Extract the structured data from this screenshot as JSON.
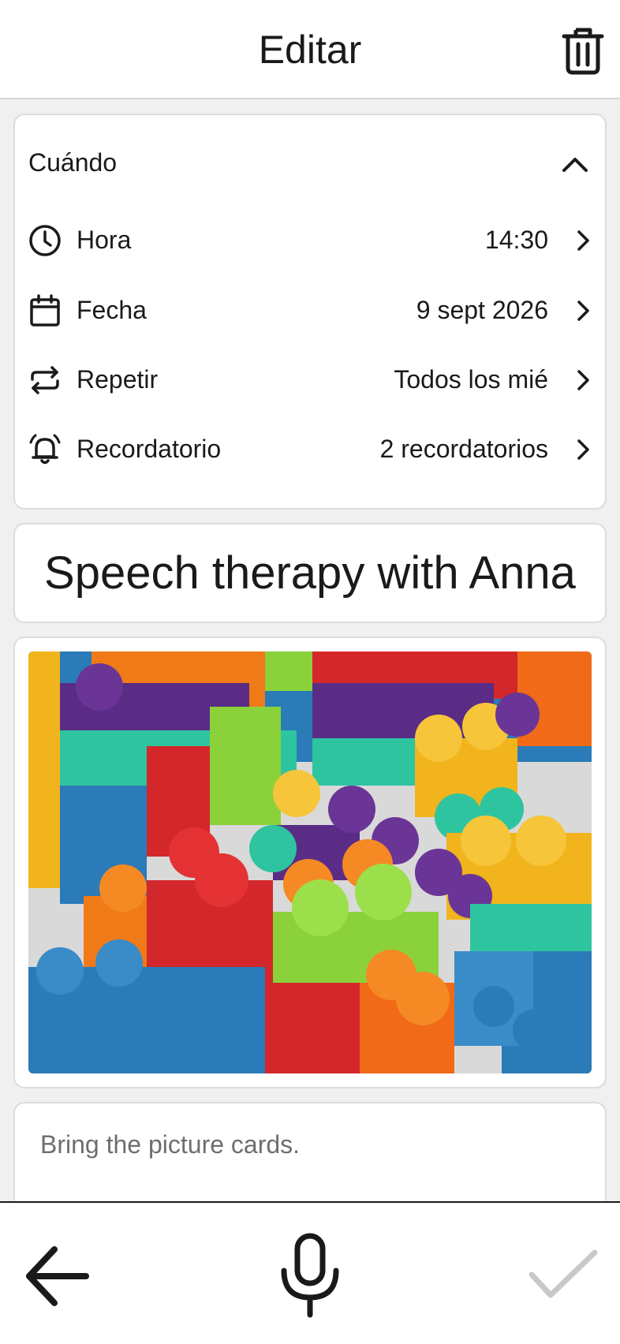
{
  "header": {
    "title": "Editar",
    "delete_icon": "trash-icon"
  },
  "when_section": {
    "label": "Cuándo",
    "collapse_icon": "chevron-up-icon",
    "rows": [
      {
        "icon": "clock-icon",
        "label": "Hora",
        "value": "14:30"
      },
      {
        "icon": "calendar-icon",
        "label": "Fecha",
        "value": "9 sept 2026"
      },
      {
        "icon": "repeat-icon",
        "label": "Repetir",
        "value": "Todos los mié"
      },
      {
        "icon": "alarm-bell-icon",
        "label": "Recordatorio",
        "value": "2 recordatorios"
      }
    ]
  },
  "activity": {
    "name": "Speech therapy with Anna"
  },
  "photo": {
    "subject": "colorful toy building blocks"
  },
  "note": {
    "text": "Bring the picture cards."
  },
  "bottom_bar": {
    "back_icon": "arrow-left-icon",
    "mic_icon": "microphone-icon",
    "confirm_icon": "checkmark-icon"
  },
  "colors": {
    "background": "#f0f0f0",
    "card": "#ffffff",
    "text": "#1a1a1a",
    "note_text": "#6e6e6e",
    "confirm_disabled": "#c8c8c8"
  }
}
